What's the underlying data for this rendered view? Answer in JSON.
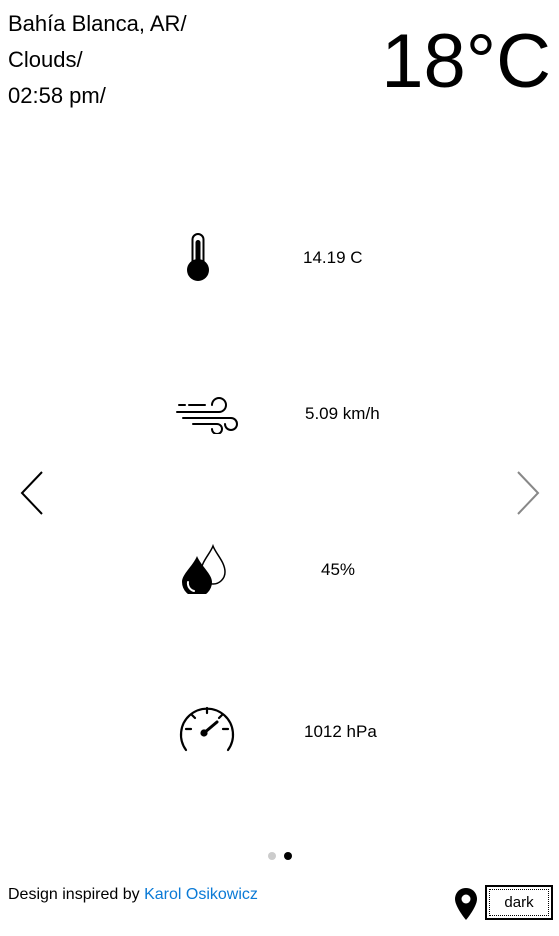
{
  "location": {
    "city_line": "Bahía Blanca, AR/",
    "condition_line": "Clouds/",
    "time_line": "02:58 pm/"
  },
  "current_temp": "18°C",
  "slides": [
    {
      "icon": "thermometer-icon",
      "value": "14.19 C"
    },
    {
      "icon": "wind-icon",
      "value": "5.09 km/h"
    },
    {
      "icon": "humidity-drops-icon",
      "value": "45%"
    },
    {
      "icon": "pressure-gauge-icon",
      "value": "1012 hPa"
    }
  ],
  "carousel": {
    "prev_icon": "chevron-left-icon",
    "next_icon": "chevron-right-icon",
    "active_index": 1,
    "dot_colors": {
      "inactive": "#cccccc",
      "active": "#000000"
    }
  },
  "footer": {
    "credit_prefix": "Design inspired by ",
    "credit_name": "Karol Osikowicz",
    "link_color": "#0a7ad6",
    "location_icon": "map-pin-icon",
    "theme_button_label": "dark"
  }
}
